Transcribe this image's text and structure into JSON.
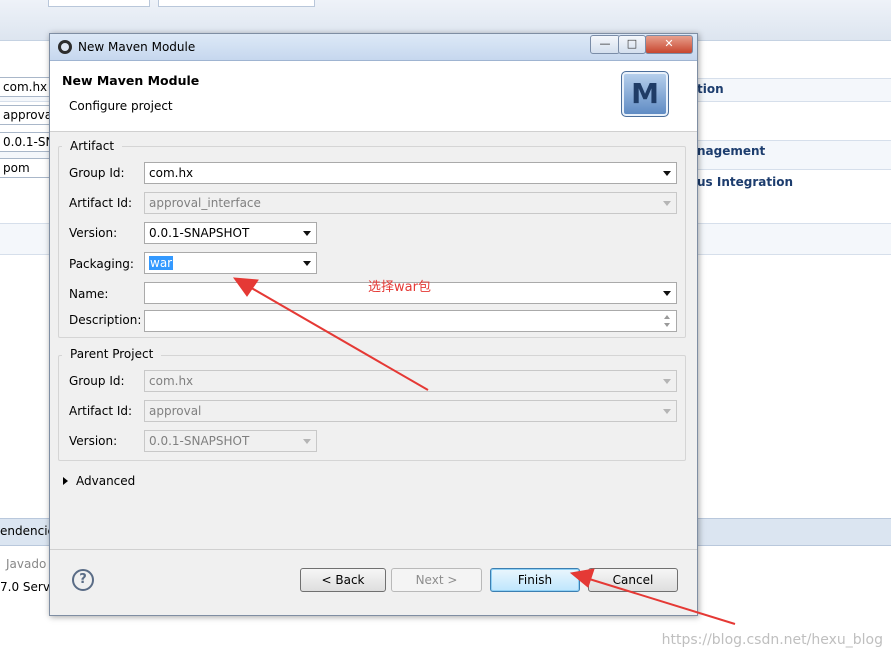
{
  "background": {
    "fields": [
      "com.hx",
      "approva",
      "0.0.1-SN",
      "pom"
    ],
    "headings": [
      "tion",
      "nagement",
      "us Integration"
    ],
    "bottom_tab": "endencies",
    "bottom_left": [
      "Javado",
      "7.0 Serve"
    ],
    "watermark": "https://blog.csdn.net/hexu_blog"
  },
  "dialog": {
    "window_title": "New Maven Module",
    "header_title": "New Maven Module",
    "header_subtitle": "Configure project",
    "logo_letter": "M",
    "artifact": {
      "section": "Artifact",
      "group_id_label": "Group Id:",
      "group_id": "com.hx",
      "artifact_id_label": "Artifact Id:",
      "artifact_id": "approval_interface",
      "version_label": "Version:",
      "version": "0.0.1-SNAPSHOT",
      "packaging_label": "Packaging:",
      "packaging": "war",
      "name_label": "Name:",
      "name": "",
      "description_label": "Description:",
      "description": ""
    },
    "parent": {
      "section": "Parent Project",
      "group_id_label": "Group Id:",
      "group_id": "com.hx",
      "artifact_id_label": "Artifact Id:",
      "artifact_id": "approval",
      "version_label": "Version:",
      "version": "0.0.1-SNAPSHOT"
    },
    "advanced": "Advanced",
    "buttons": {
      "back": "< Back",
      "next": "Next >",
      "finish": "Finish",
      "cancel": "Cancel"
    }
  },
  "annotation": {
    "text": "选择war包",
    "color": "#e53935"
  }
}
